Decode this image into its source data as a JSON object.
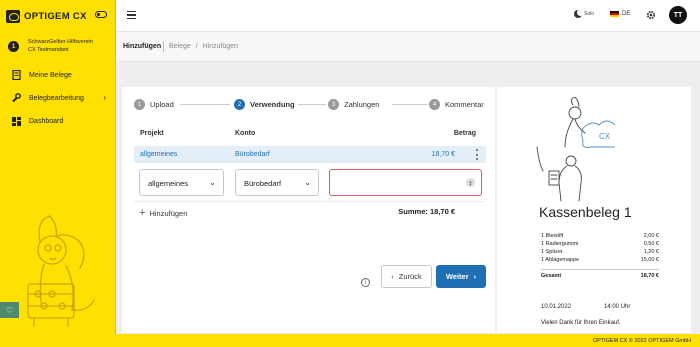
{
  "app": {
    "name": "OPTIGEM CX"
  },
  "sidebar": {
    "org_number": "1",
    "org_line1": "SchwarzGelber Hilfsverein",
    "org_line2": "CX Testmandant",
    "items": [
      {
        "label": "Meine Belege",
        "icon": "receipt-icon"
      },
      {
        "label": "Belegbearbeitung",
        "icon": "wrench-icon"
      },
      {
        "label": "Dashboard",
        "icon": "dashboard-icon"
      }
    ]
  },
  "topbar": {
    "theme_label": "Solo",
    "language": "DE",
    "avatar_initials": "TT"
  },
  "header": {
    "title": "Hinzufügen",
    "breadcrumb": [
      "Belege",
      "/",
      "Hinzufügen"
    ]
  },
  "steps": [
    {
      "number": "1",
      "label": "Upload"
    },
    {
      "number": "2",
      "label": "Verwendung"
    },
    {
      "number": "3",
      "label": "Zahlungen"
    },
    {
      "number": "4",
      "label": "Kommentar"
    }
  ],
  "table": {
    "headers": {
      "projekt": "Projekt",
      "konto": "Konto",
      "betrag": "Betrag"
    },
    "row": {
      "projekt": "allgemeines",
      "konto": "Bürobedarf",
      "betrag": "18,70 €"
    }
  },
  "form": {
    "projekt_value": "allgemeines",
    "konto_value": "Bürobedarf",
    "betrag_value": ""
  },
  "add_label": "Hinzufügen",
  "sum_label": "Summe: 18,70 €",
  "buttons": {
    "back": "Zurück",
    "next": "Weiter"
  },
  "receipt": {
    "logo_text": "CX",
    "title": "Kassenbeleg 1",
    "items": [
      {
        "name": "1 Bleistift",
        "price": "2,00 €"
      },
      {
        "name": "1 Radiergummi",
        "price": "0,50 €"
      },
      {
        "name": "1 Spitzer",
        "price": "1,20 €"
      },
      {
        "name": "1 Ablagemappe",
        "price": "15,00 €"
      }
    ],
    "total_label": "Gesamt",
    "total_value": "18,70 €",
    "date": "10.01.2022",
    "time": "14:00 Uhr",
    "thanks": "Vielen Dank für Ihren Einkauf."
  },
  "footer": "OPTIGEM CX © 2022 OPTIGEM GmbH",
  "colors": {
    "accent": "#1e6fb3",
    "brand": "#ffe000",
    "error": "#d02020"
  }
}
